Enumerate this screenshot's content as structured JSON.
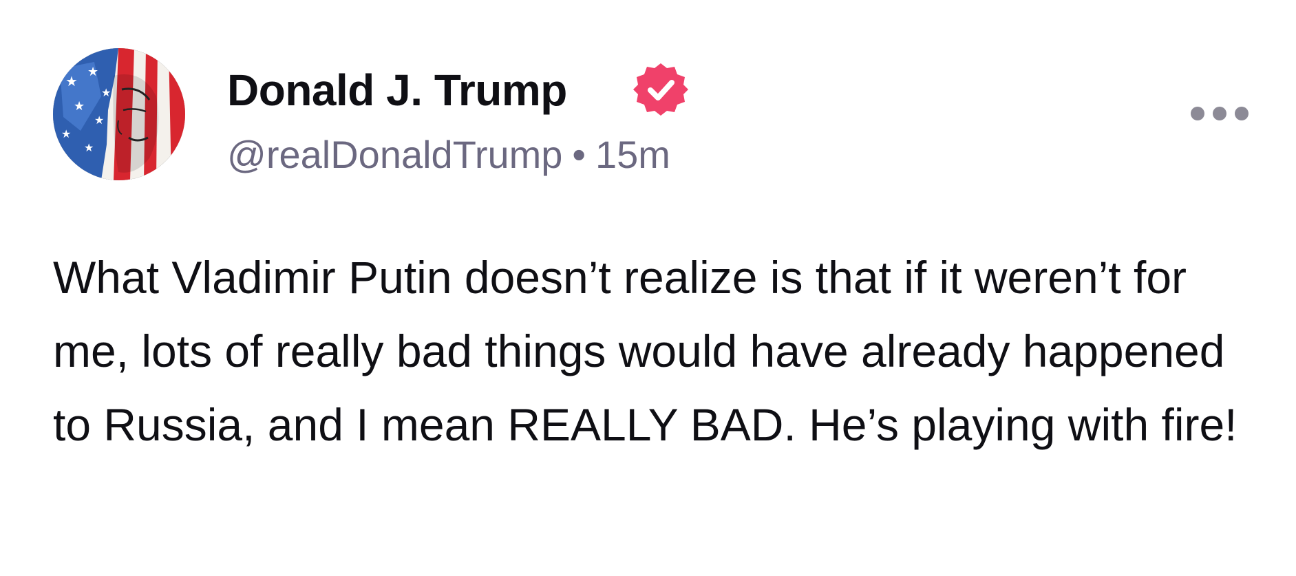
{
  "post": {
    "author_name": "Donald J. Trump",
    "handle": "@realDonaldTrump",
    "separator": "•",
    "time_ago": "15m",
    "verified_icon": "verified-badge-icon",
    "more_icon": "more-options-icon",
    "text": "What Vladimir Putin doesn’t realize is that if it weren’t for me, lots of really bad things would have already happened to Russia, and I mean REALLY BAD. He’s playing with fire!"
  },
  "colors": {
    "verified_badge": "#f0416a",
    "meta_text": "#6b6880",
    "more_dots": "#8c8a96",
    "body_text": "#0f0f14"
  }
}
